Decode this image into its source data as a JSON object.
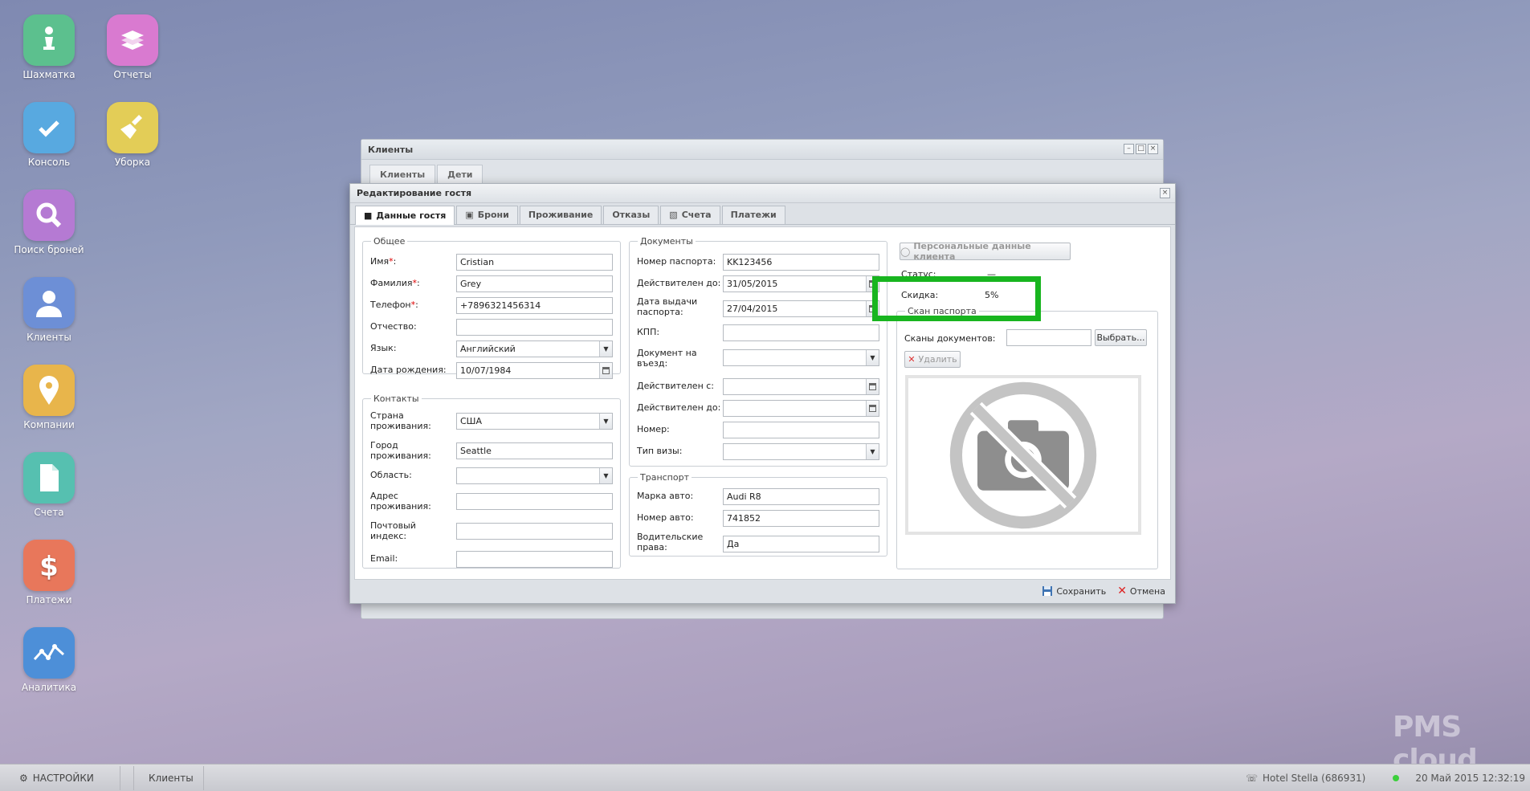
{
  "desktop": {
    "icons": [
      {
        "label": "Шахматка",
        "color": "#5cc08e",
        "icon": "chess-pawn-icon"
      },
      {
        "label": "Отчеты",
        "color": "#d97ad0",
        "icon": "books-icon"
      },
      {
        "label": "Консоль",
        "color": "#58a9e0",
        "icon": "checkmark-icon"
      },
      {
        "label": "Уборка",
        "color": "#e3cd57",
        "icon": "broom-icon"
      },
      {
        "label": "Поиск броней",
        "color": "#b57ad3",
        "icon": "magnifier-icon"
      },
      {
        "label": "Клиенты",
        "color": "#6d8fd6",
        "icon": "person-icon"
      },
      {
        "label": "Компании",
        "color": "#e8b54b",
        "icon": "map-pin-icon"
      },
      {
        "label": "Счета",
        "color": "#56c0b0",
        "icon": "document-icon"
      },
      {
        "label": "Платежи",
        "color": "#e8775b",
        "icon": "dollar-icon"
      },
      {
        "label": "Аналитика",
        "color": "#4d8fd8",
        "icon": "chart-line-icon"
      }
    ]
  },
  "bg_window": {
    "title": "Клиенты",
    "tabs": [
      "Клиенты",
      "Дети"
    ]
  },
  "dialog": {
    "title": "Редактирование гостя",
    "tabs": [
      "Данные гостя",
      "Брони",
      "Проживание",
      "Отказы",
      "Счета",
      "Платежи"
    ],
    "general": {
      "legend": "Общее",
      "first_name_label": "Имя",
      "first_name": "Cristian",
      "last_name_label": "Фамилия",
      "last_name": "Grey",
      "phone_label": "Телефон",
      "phone": "+7896321456314",
      "patronymic_label": "Отчество:",
      "patronymic": "",
      "language_label": "Язык:",
      "language": "Английский",
      "birth_label": "Дата рождения:",
      "birth": "10/07/1984"
    },
    "contacts": {
      "legend": "Контакты",
      "country_label": "Страна проживания:",
      "country": "США",
      "city_label": "Город проживания:",
      "city": "Seattle",
      "region_label": "Область:",
      "region": "",
      "address_label": "Адрес проживания:",
      "address": "",
      "zip_label": "Почтовый индекс:",
      "zip": "",
      "email_label": "Email:",
      "email": ""
    },
    "documents": {
      "legend": "Документы",
      "passport_no_label": "Номер паспорта:",
      "passport_no": "KK123456",
      "valid_to_label": "Действителен до:",
      "valid_to": "31/05/2015",
      "issue_date_label": "Дата выдачи паспорта:",
      "issue_date": "27/04/2015",
      "kpp_label": "КПП:",
      "kpp": "",
      "entry_doc_label": "Документ на въезд:",
      "entry_doc": "",
      "valid_from2_label": "Действителен с:",
      "valid_from2": "",
      "valid_to2_label": "Действителен до:",
      "valid_to2": "",
      "number_label": "Номер:",
      "number": "",
      "visa_type_label": "Тип визы:",
      "visa_type": ""
    },
    "transport": {
      "legend": "Транспорт",
      "car_label": "Марка авто:",
      "car": "Audi R8",
      "car_no_label": "Номер авто:",
      "car_no": "741852",
      "license_label": "Водительские права:",
      "license": "Да"
    },
    "side": {
      "personal_btn": "Персональные данные клиента",
      "status_label": "Статус:",
      "status": "—",
      "discount_label": "Скидка:",
      "discount": "5%",
      "scan_legend": "Скан паспорта",
      "scans_label": "Сканы документов:",
      "choose_btn": "Выбрать...",
      "delete_btn": "Удалить"
    },
    "footer": {
      "save": "Сохранить",
      "cancel": "Отмена"
    }
  },
  "taskbar": {
    "settings": "НАСТРОЙКИ",
    "window": "Клиенты",
    "hotel": "Hotel Stella (686931)",
    "datetime": "20 Май 2015 12:32:19"
  },
  "watermark": "PMS cloud",
  "highlight_color": "#18b51f"
}
